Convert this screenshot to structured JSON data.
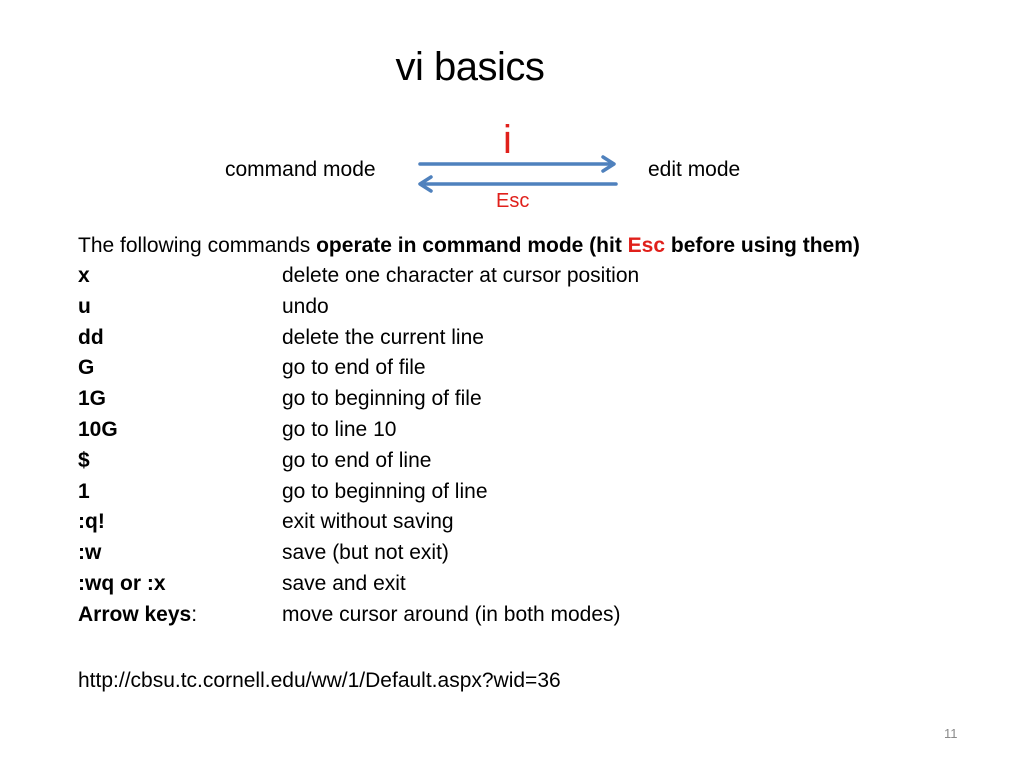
{
  "slide": {
    "title": "vi basics",
    "page_number": "11"
  },
  "diagram": {
    "left_mode": "command mode",
    "right_mode": "edit mode",
    "forward_label": "i",
    "backward_label": "Esc",
    "arrow_color": "#4f81bd",
    "label_color": "#e0201b"
  },
  "intro": {
    "plain": "The following commands ",
    "bold_before": "operate in command mode (hit ",
    "esc": "Esc",
    "bold_after": " before using them)"
  },
  "commands": [
    {
      "key": "x",
      "description": "delete one character at cursor position"
    },
    {
      "key": "u",
      "description": "undo"
    },
    {
      "key": "dd",
      "description": "delete the current line"
    },
    {
      "key": "G",
      "description": "go to end of file"
    },
    {
      "key": "1G",
      "description": "go to beginning of file"
    },
    {
      "key": "10G",
      "description": "go to line 10"
    },
    {
      "key": "$",
      "description": "go to end of line"
    },
    {
      "key": "1",
      "description": "go to beginning of line"
    },
    {
      "key": ":q!",
      "description": "exit without saving"
    },
    {
      "key": ":w",
      "description": "save (but not exit)"
    },
    {
      "key": ":wq or :x",
      "description": "save and exit"
    },
    {
      "key": "Arrow keys",
      "key_suffix": ":",
      "description": "move cursor around (in both modes)"
    }
  ],
  "footer": {
    "url": "http://cbsu.tc.cornell.edu/ww/1/Default.aspx?wid=36"
  }
}
